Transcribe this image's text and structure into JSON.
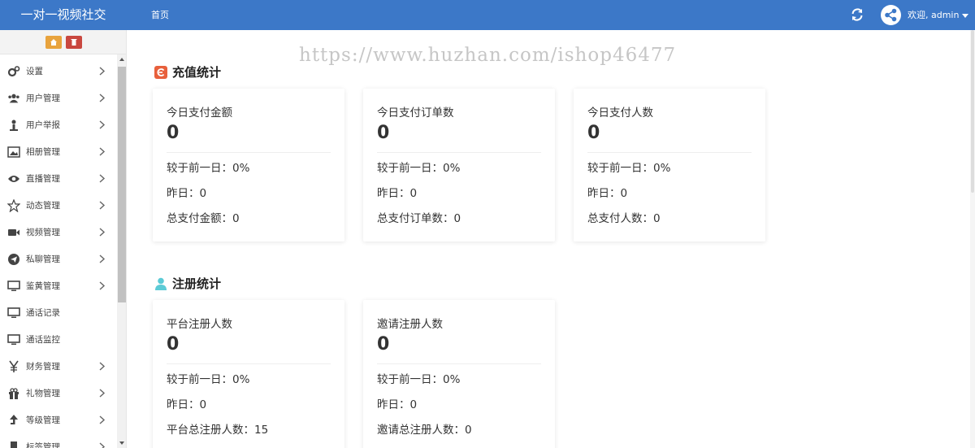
{
  "header": {
    "brand": "一对一视频社交",
    "nav_home": "首页",
    "welcome": "欢迎, admin",
    "bg_color": "#3c78c8",
    "icons": [
      "refresh-icon",
      "avatar-share-icon",
      "caret-down-icon"
    ]
  },
  "sidebar": {
    "tools": [
      "home-icon",
      "trash-icon"
    ],
    "items": [
      {
        "label": "设置",
        "icon": "gears-icon",
        "has_children": true
      },
      {
        "label": "用户管理",
        "icon": "users-icon",
        "has_children": true
      },
      {
        "label": "用户举报",
        "icon": "user-report-icon",
        "has_children": true
      },
      {
        "label": "相册管理",
        "icon": "image-icon",
        "has_children": true
      },
      {
        "label": "直播管理",
        "icon": "eye-icon",
        "has_children": true
      },
      {
        "label": "动态管理",
        "icon": "star-icon",
        "has_children": true
      },
      {
        "label": "视频管理",
        "icon": "video-camera-icon",
        "has_children": true
      },
      {
        "label": "私聊管理",
        "icon": "send-icon",
        "has_children": true
      },
      {
        "label": "鉴黄管理",
        "icon": "monitor-icon",
        "has_children": true
      },
      {
        "label": "通话记录",
        "icon": "monitor-icon",
        "has_children": false
      },
      {
        "label": "通话监控",
        "icon": "monitor-icon",
        "has_children": false
      },
      {
        "label": "财务管理",
        "icon": "yen-icon",
        "has_children": true
      },
      {
        "label": "礼物管理",
        "icon": "gift-icon",
        "has_children": true
      },
      {
        "label": "等级管理",
        "icon": "level-up-icon",
        "has_children": true
      },
      {
        "label": "标签管理",
        "icon": "bookmark-icon",
        "has_children": true
      }
    ]
  },
  "watermark": "https://www.huzhan.com/ishop46477",
  "recharge": {
    "title": "充值统计",
    "icon": "recharge-icon",
    "icon_color": "#e8603c",
    "cards": [
      {
        "title": "今日支付金额",
        "value": "0",
        "rows": [
          "较于前一日：0%",
          "昨日：0",
          "总支付金额：0"
        ]
      },
      {
        "title": "今日支付订单数",
        "value": "0",
        "rows": [
          "较于前一日：0%",
          "昨日：0",
          "总支付订单数：0"
        ]
      },
      {
        "title": "今日支付人数",
        "value": "0",
        "rows": [
          "较于前一日：0%",
          "昨日：0",
          "总支付人数：0"
        ]
      }
    ]
  },
  "register": {
    "title": "注册统计",
    "icon": "user-icon",
    "icon_color": "#5ccbd6",
    "cards": [
      {
        "title": "平台注册人数",
        "value": "0",
        "rows": [
          "较于前一日：0%",
          "昨日：0",
          "平台总注册人数：15"
        ]
      },
      {
        "title": "邀请注册人数",
        "value": "0",
        "rows": [
          "较于前一日：0%",
          "昨日：0",
          "邀请总注册人数：0"
        ]
      }
    ]
  }
}
